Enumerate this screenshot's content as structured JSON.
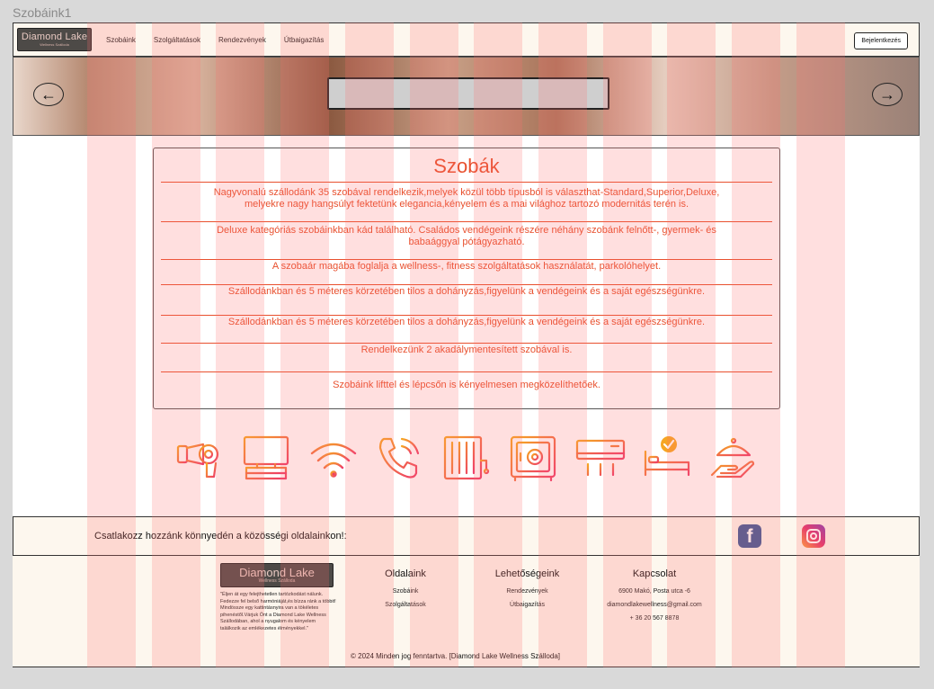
{
  "frame_title": "Szobáink1",
  "nav": {
    "logo_main": "Diamond Lake",
    "logo_sub": "Wellness Szálloda",
    "links": [
      "Szobáink",
      "Szolgáltatások",
      "Rendezvények",
      "Útbaigazítás"
    ],
    "login_label": "Bejelentkezés"
  },
  "hero": {
    "prev_icon": "arrow-left-icon",
    "next_icon": "arrow-right-icon"
  },
  "rooms": {
    "title": "Szobák",
    "paragraphs": [
      "Nagyvonalú szállodánk 35 szobával rendelkezik,melyek közül több típusból is választhat-Standard,Superior,Deluxe, melyekre nagy hangsúlyt fektetünk eleganciа,kényelem és a mai világhoz tartozó modernitás terén is.",
      "Deluxe kategóriás szobáinkban kád található. Családos vendégeink részére néhány szobánk felnőtt-, gyermek- és babaággyal pótágyazható.",
      "A szobaár magába foglalja a wellness-, fitness szolgáltatások használatát, parkolóhelyet.",
      "Szállodánkban és 5 méteres körzetében tilos a dohányzás,figyelünk a vendégeink és a saját egészségünkre.",
      "Szállodánkban és 5 méteres körzetében tilos a dohányzás,figyelünk a vendégeink és a saját egészségünkre.",
      "Rendelkezünk 2 akadálymentesített szobával is.",
      "Szobáink lifttel és lépcsőn is kényelmesen megközelíthetőek."
    ]
  },
  "amenities": [
    "hair-dryer-icon",
    "tv-icon",
    "wifi-icon",
    "phone-icon",
    "minibar-icon",
    "safe-icon",
    "air-conditioner-icon",
    "room-service-bed-icon",
    "room-service-cloche-icon"
  ],
  "social": {
    "text": "Csatlakozz hozzánk könnyedén a közösségi oldalainkon!:",
    "icons": [
      "facebook-icon",
      "instagram-icon"
    ],
    "facebook_glyph": "f"
  },
  "footer": {
    "logo_main": "Diamond Lake",
    "logo_sub": "Wellness Szálloda",
    "description": "\"Éljen át egy felejthetetlen tartózkodást nálunk. Fedezze fel belső harmóniáját,és bízza ránk a többit! Mindössze egy kattintásnyira van a tökéletes pihenéstől.Várjuk Önt a Diamond Lake Wellness Szállodában, ahol a nyugalom és kényelem találkozik az emlékezetes élményekkel.\"",
    "col1": {
      "title": "Oldalaink",
      "items": [
        "Szobáink",
        "Szolgáltatások"
      ]
    },
    "col2": {
      "title": "Lehetőségeink",
      "items": [
        "Rendezvények",
        "Útbaigazítás"
      ]
    },
    "col3": {
      "title": "Kapcsolat",
      "items": [
        "6900 Makó, Posta  utca -6",
        "diamondlakewellness@gmail.com",
        "+ 36 20 567 8878"
      ]
    },
    "copyright": "© 2024 Minden jog fenntartva. [Diamond Lake Wellness Szálloda]"
  },
  "colors": {
    "accent": "#e8502e",
    "nav_bg": "#fdf7ee",
    "logo_bg": "#4d4a47",
    "grid_overlay": "#ff6e6e"
  }
}
